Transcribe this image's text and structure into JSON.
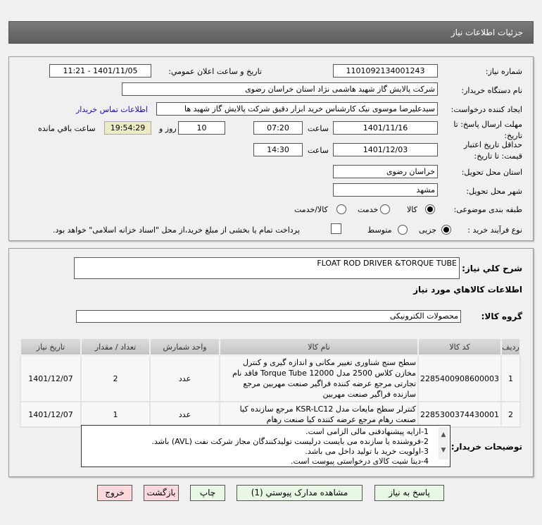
{
  "header": {
    "title": "جزئیات اطلاعات نیاز"
  },
  "form": {
    "need_number_label": "شماره نیاز:",
    "need_number": "1101092134001243",
    "announce_label": "تاریخ و ساعت اعلان عمومي:",
    "announce_value": "1401/11/05 - 11:21",
    "buyer_label": "نام دستگاه خریدار:",
    "buyer_value": "شرکت پالایش گاز شهید هاشمی نژاد   استان خراسان رضوی",
    "requester_label": "ایجاد کننده درخواست:",
    "requester_value": "سیدعلیرضا موسوی نیک کارشناس خرید ابزار دقیق شرکت پالایش گاز شهید ها",
    "contact_link": "اطلاعات تماس خریدار",
    "deadline_label_1": "مهلت ارسال پاسخ: تا",
    "deadline_label_2": "تاریخ:",
    "deadline_date": "1401/11/16",
    "time_label": "ساعت",
    "deadline_time": "07:20",
    "days": "10",
    "days_label": "روز و",
    "remaining": "19:54:29",
    "remaining_label": "ساعت باقي مانده",
    "validity_label_1": "حداقل تاریخ اعتبار",
    "validity_label_2": "قیمت: تا تاریخ:",
    "validity_date": "1401/12/03",
    "validity_time": "14:30",
    "province_label": "استان محل تحویل:",
    "province": "خراسان رضوی",
    "city_label": "شهر محل تحویل:",
    "city": "مشهد",
    "category_label": "طبقه بندی موضوعی:",
    "category_options": [
      "کالا",
      "خدمت",
      "کالا/خدمت"
    ],
    "category_selected": "کالا",
    "process_label": "نوع فرآیند خرید :",
    "process_options": [
      "جزیی",
      "متوسط"
    ],
    "process_selected": "جزیی",
    "payment_note": "پرداخت تمام یا بخشی از مبلغ خرید،از محل \"اسناد خزانه اسلامی\" خواهد بود."
  },
  "details": {
    "desc_label": "شرح کلي نياز:",
    "desc_value": "FLOAT ROD DRIVER &TORQUE TUBE",
    "goods_title": "اطلاعات کالاهاي مورد نياز",
    "group_label": "گروه کالا:",
    "group_value": "محصولات الکترونیکی",
    "table": {
      "headers": [
        "ردیف",
        "کد کالا",
        "نام کالا",
        "واحد شمارش",
        "تعداد / مقدار",
        "تاریخ نیاز"
      ],
      "rows": [
        [
          "1",
          "2285400908600003",
          "سطح سنج شناوری تغییر مکانی و اندازه گیری و کنترل مخازن کلاس 2500 مدل Torque Tube 12000 فاقد نام تجارتی مرجع عرضه کننده فراگیر صنعت مهربین مرجع سازنده فراگیر صنعت مهربین",
          "عدد",
          "2",
          "1401/12/07"
        ],
        [
          "2",
          "2285300374430001",
          "کنترلر سطح مایعات مدل KSR-LC12 مرجع سازنده کیا صنعت رهام مرجع عرضه کننده کیا صنعت رهام",
          "عدد",
          "1",
          "1401/12/07"
        ]
      ]
    },
    "notes_label": "توضیحات خریدار:",
    "notes": [
      "1-ارایه پیشنهادفنی مالی الزامی است.",
      "2-فروشنده یا سازنده می بایست درلیست تولیدکنندگان مجاز شرکت نفت (AVL)  باشد.",
      "3-اولویت خرید با  تولید داخل می باشد.",
      "4-دیتا شیت کالای درخواستی پیوست است."
    ]
  },
  "buttons": {
    "reply": "پاسخ به نياز",
    "attachments": "مشاهده مدارک پيوستي (1)",
    "print": "چاپ",
    "back": "بازگشت",
    "exit": "خروج"
  },
  "colors": {
    "header_bg": "#666666",
    "link": "#1a0dab",
    "remaining_bg": "#ececc4",
    "green_btn": "#e8f8e4",
    "pink_btn": "#fbd9dc"
  }
}
